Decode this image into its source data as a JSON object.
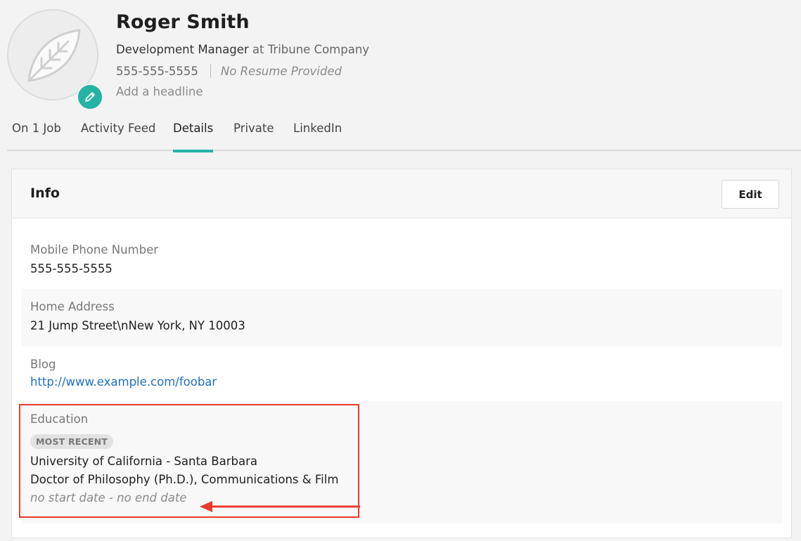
{
  "profile": {
    "name": "Roger Smith",
    "title": "Development Manager",
    "at_word": "at",
    "company": "Tribune Company",
    "phone": "555-555-5555",
    "resume_status": "No Resume Provided",
    "headline_prompt": "Add a headline"
  },
  "tabs": [
    {
      "label": "On 1 Job",
      "active": false
    },
    {
      "label": "Activity Feed",
      "active": false
    },
    {
      "label": "Details",
      "active": true
    },
    {
      "label": "Private",
      "active": false
    },
    {
      "label": "LinkedIn",
      "active": false
    }
  ],
  "info_card": {
    "title": "Info",
    "edit_label": "Edit",
    "fields": {
      "mobile": {
        "label": "Mobile Phone Number",
        "value": "555-555-5555"
      },
      "address": {
        "label": "Home Address",
        "value": "21 Jump Street\\nNew York, NY 10003"
      },
      "blog": {
        "label": "Blog",
        "value": "http://www.example.com/foobar"
      },
      "education": {
        "label": "Education",
        "badge": "MOST RECENT",
        "school": "University of California - Santa Barbara",
        "degree": "Doctor of Philosophy (Ph.D.), Communications & Film",
        "dates": "no start date - no end date"
      }
    }
  },
  "colors": {
    "accent": "#25b3a5",
    "link": "#1f6fc2",
    "annotation": "#ea3a2e"
  },
  "icons": {
    "avatar_placeholder": "leaf-icon",
    "avatar_edit": "pencil-icon",
    "annotation_arrow": "arrow-left-icon"
  }
}
